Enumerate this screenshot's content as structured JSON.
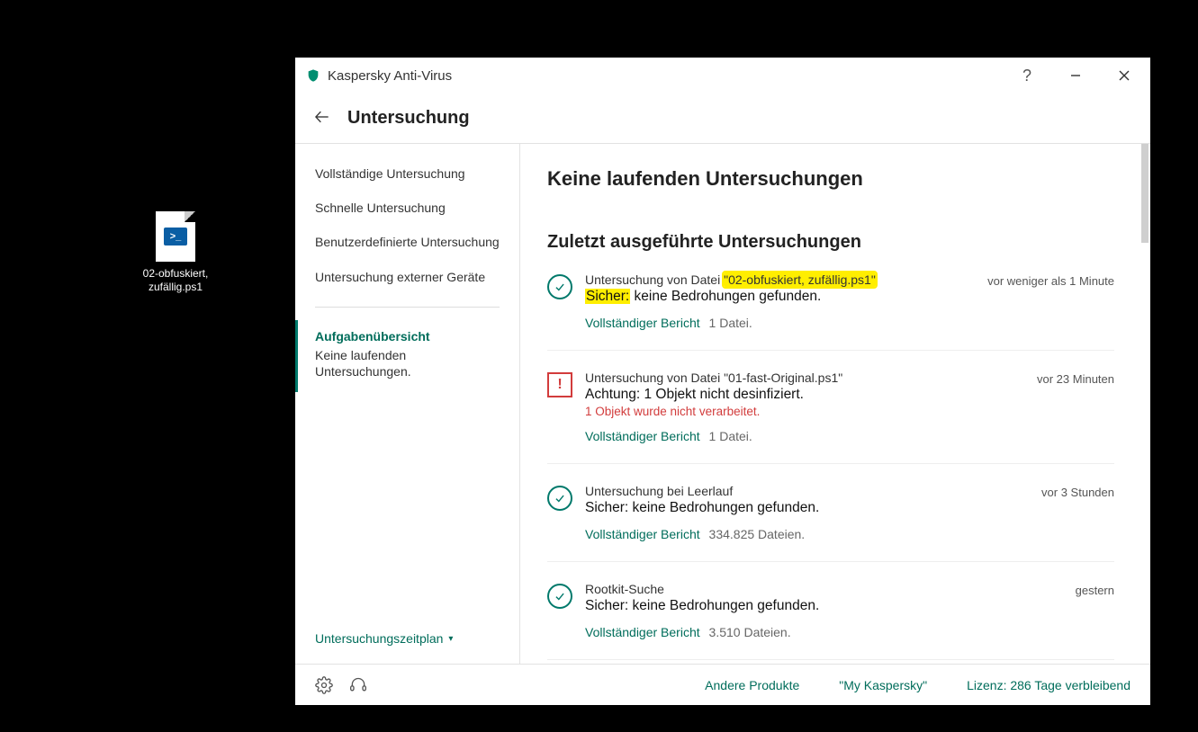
{
  "desktop": {
    "file_label": "02-obfuskiert, zufällig.ps1"
  },
  "app": {
    "title": "Kaspersky Anti-Virus",
    "subtitle": "Untersuchung"
  },
  "sidebar": {
    "items": [
      "Vollständige Untersuchung",
      "Schnelle Untersuchung",
      "Benutzerdefinierte Untersuchung",
      "Untersuchung externer Geräte"
    ],
    "group": {
      "title": "Aufgabenübersicht",
      "sub": "Keine laufenden Untersuchungen."
    },
    "footer": "Untersuchungszeitplan"
  },
  "content": {
    "heading_running": "Keine laufenden Untersuchungen",
    "heading_recent": "Zuletzt ausgeführte Untersuchungen",
    "report_link": "Vollständiger Bericht",
    "scans": [
      {
        "status": "ok",
        "line1_prefix": "Untersuchung von Datei ",
        "line1_highlight": "\"02-obfuskiert, zufällig.ps1\"",
        "line2_prefix_highlight": "Sicher:",
        "line2_rest": " keine Bedrohungen gefunden.",
        "files": "1 Datei.",
        "time": "vor weniger als 1 Minute"
      },
      {
        "status": "warn",
        "line1": "Untersuchung von Datei \"01-fast-Original.ps1\"",
        "line2": "Achtung: 1 Objekt nicht desinfiziert.",
        "lineErr": "1 Objekt wurde nicht verarbeitet.",
        "files": "1 Datei.",
        "time": "vor 23 Minuten"
      },
      {
        "status": "ok",
        "line1": "Untersuchung bei Leerlauf",
        "line2": "Sicher: keine Bedrohungen gefunden.",
        "files": "334.825 Dateien.",
        "time": "vor 3 Stunden"
      },
      {
        "status": "ok",
        "line1": "Rootkit-Suche",
        "line2": "Sicher: keine Bedrohungen gefunden.",
        "files": "3.510 Dateien.",
        "time": "gestern"
      }
    ]
  },
  "footer": {
    "links": [
      "Andere Produkte",
      "\"My Kaspersky\"",
      "Lizenz: 286 Tage verbleibend"
    ]
  }
}
